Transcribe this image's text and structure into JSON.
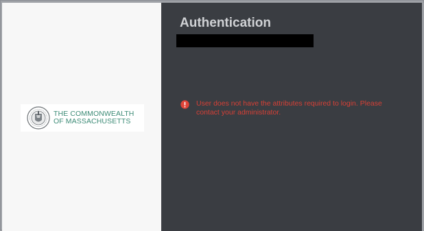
{
  "branding": {
    "logo_line1": "THE COMMONWEALTH",
    "logo_line2": "OF MASSACHUSETTS",
    "seal_icon": "massachusetts-seal-icon",
    "logo_color": "#3c8b76"
  },
  "auth": {
    "title": "Authentication",
    "error_icon": "error-circle-icon",
    "error_message": "User does not have the attributes required to login. Please contact your administrator.",
    "error_color": "#d74036"
  },
  "colors": {
    "left_panel": "#f7f7f7",
    "right_panel": "#3a3d42",
    "title": "#d0d2d5"
  }
}
